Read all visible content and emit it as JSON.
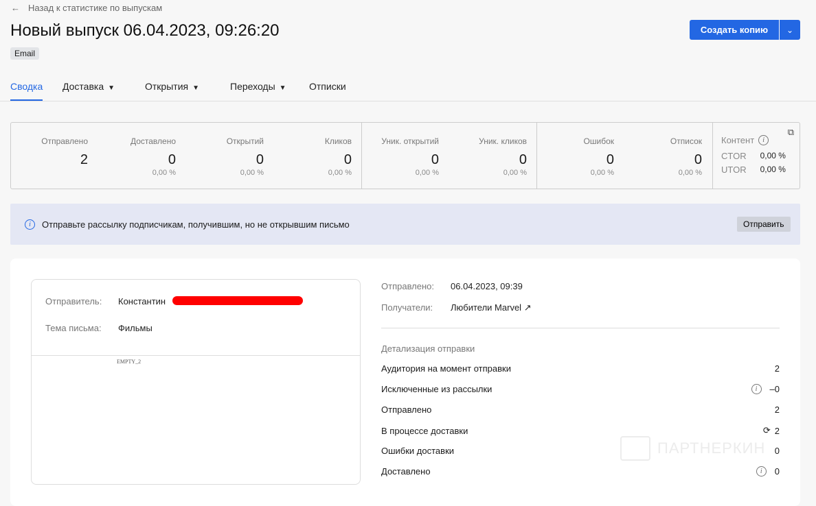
{
  "header": {
    "back_label": "Назад к статистике по выпускам",
    "title": "Новый выпуск 06.04.2023, 09:26:20",
    "badge": "Email",
    "copy_button": "Создать копию"
  },
  "tabs": [
    {
      "label": "Сводка",
      "active": true
    },
    {
      "label": "Доставка"
    },
    {
      "label": "Открытия"
    },
    {
      "label": "Переходы"
    },
    {
      "label": "Отписки"
    }
  ],
  "stats": [
    {
      "label": "Отправлено",
      "value": "2",
      "percent": ""
    },
    {
      "label": "Доставлено",
      "value": "0",
      "percent": "0,00 %"
    },
    {
      "label": "Открытий",
      "value": "0",
      "percent": "0,00 %"
    },
    {
      "label": "Кликов",
      "value": "0",
      "percent": "0,00 %"
    },
    {
      "label": "Уник. открытий",
      "value": "0",
      "percent": "0,00 %"
    },
    {
      "label": "Уник. кликов",
      "value": "0",
      "percent": "0,00 %"
    },
    {
      "label": "Ошибок",
      "value": "0",
      "percent": "0,00 %"
    },
    {
      "label": "Отписок",
      "value": "0",
      "percent": "0,00 %"
    }
  ],
  "content": {
    "title": "Контент",
    "ctor_label": "CTOR",
    "ctor": "0,00 %",
    "utor_label": "UTOR",
    "utor": "0,00 %"
  },
  "banner": {
    "text": "Отправьте рассылку подписчикам, получившим, но не открывшим письмо",
    "button": "Отправить"
  },
  "letter": {
    "sender_label": "Отправитель:",
    "sender": "Константин",
    "subject_label": "Тема письма:",
    "subject": "Фильмы",
    "preview": "EMPTY_2"
  },
  "info": {
    "sent_label": "Отправлено:",
    "sent": "06.04.2023, 09:39",
    "recipients_label": "Получатели:",
    "recipients": "Любители Marvel"
  },
  "details": {
    "title": "Детализация отправки",
    "rows": [
      {
        "label": "Аудитория на момент отправки",
        "value": "2"
      },
      {
        "label": "Исключенные из рассылки",
        "value": "–0",
        "icon": "info-icon"
      },
      {
        "label": "Отправлено",
        "value": "2"
      },
      {
        "label": "В процессе доставки",
        "value": "2",
        "icon": "refresh-icon"
      },
      {
        "label": "Ошибки доставки",
        "value": "0"
      },
      {
        "label": "Доставлено",
        "value": "0",
        "icon": "info-icon"
      }
    ]
  },
  "watermark": "ПАРТНЕРКИН",
  "colors": {
    "accent": "#2367e3",
    "banner": "#e4e7f4",
    "redaction": "#ff0000"
  }
}
